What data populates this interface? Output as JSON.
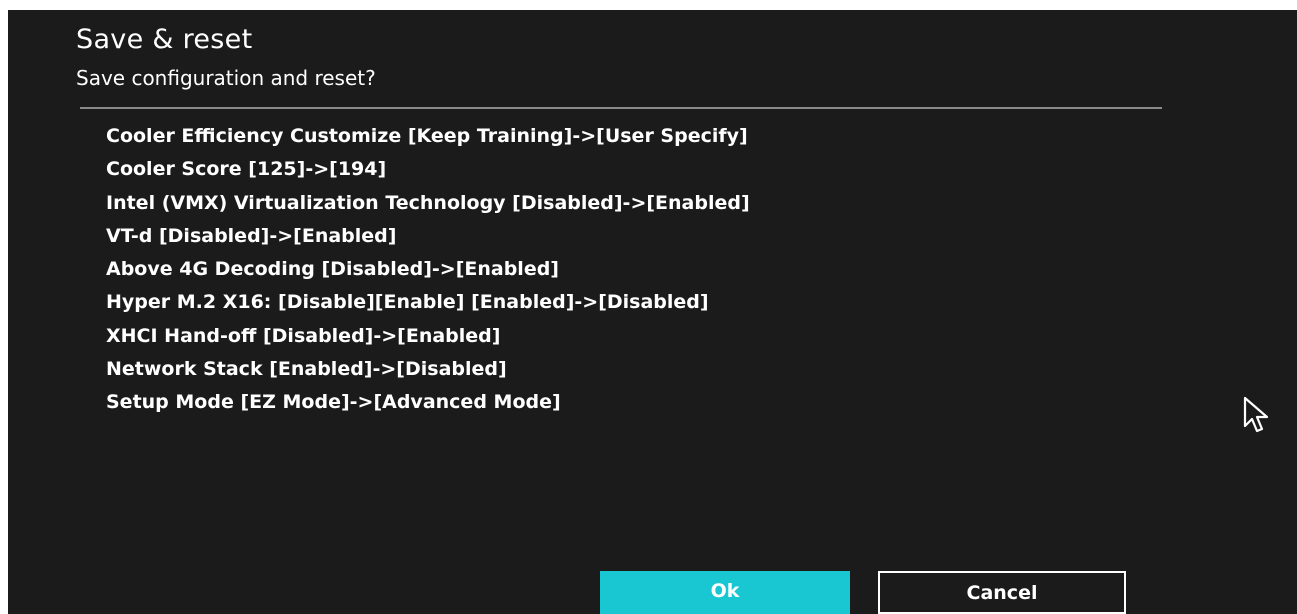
{
  "dialog": {
    "title": "Save & reset",
    "subtitle": "Save configuration and reset?"
  },
  "changes": [
    "Cooler Efficiency Customize [Keep Training]->[User Specify]",
    "Cooler Score [125]->[194]",
    "Intel (VMX) Virtualization Technology [Disabled]->[Enabled]",
    "VT-d [Disabled]->[Enabled]",
    "Above 4G Decoding [Disabled]->[Enabled]",
    "Hyper M.2 X16: [Disable][Enable] [Enabled]->[Disabled]",
    "XHCI Hand-off [Disabled]->[Enabled]",
    "Network Stack [Enabled]->[Disabled]",
    "Setup Mode [EZ Mode]->[Advanced Mode]"
  ],
  "buttons": {
    "ok_label": "Ok",
    "cancel_label": "Cancel"
  },
  "icons": {
    "cursor": "mouse-pointer-icon"
  },
  "colors": {
    "background": "#1b1b1c",
    "ok_button": "#19c7d3",
    "text": "#ffffff"
  }
}
